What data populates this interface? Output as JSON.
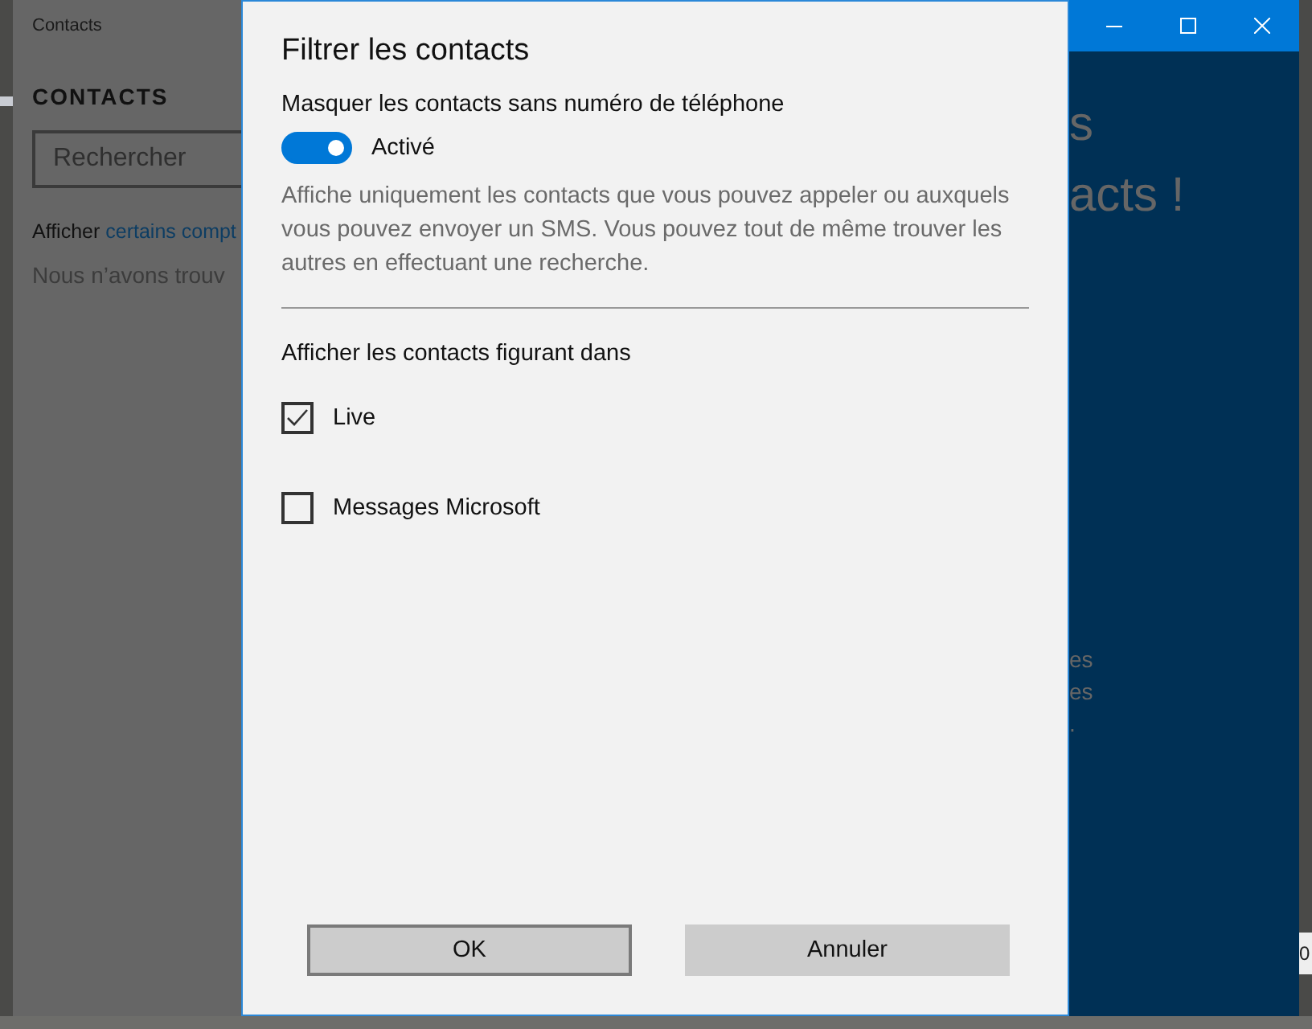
{
  "window": {
    "title": "Contacts"
  },
  "background_left": {
    "heading": "CONTACTS",
    "search": {
      "placeholder": "Rechercher"
    },
    "filter_text": "Afficher ",
    "filter_link": "certains compt",
    "empty_text": "Nous n’avons trouv"
  },
  "background_right": {
    "lines": [
      {
        "text": "s",
        "kind": "large"
      },
      {
        "text": "acts !",
        "kind": "large"
      },
      {
        "text": "es",
        "kind": "small"
      },
      {
        "text": "es",
        "kind": "small"
      },
      {
        "text": ".",
        "kind": "small"
      }
    ]
  },
  "dialog": {
    "title": "Filtrer les contacts",
    "toggle_label": "Masquer les contacts sans numéro de téléphone",
    "toggle": {
      "on": true,
      "label": "Activé"
    },
    "description": "Affiche uniquement les contacts que vous pouvez appeler ou auxquels vous pouvez envoyer un SMS. Vous pouvez tout de même trouver les autres en effectuant une recherche.",
    "sources_label": "Afficher les contacts figurant dans",
    "sources": [
      {
        "label": "Live",
        "checked": true
      },
      {
        "label": "Messages Microsoft",
        "checked": false
      }
    ],
    "buttons": [
      {
        "label": "OK",
        "focused": true
      },
      {
        "label": "Annuler",
        "focused": false
      }
    ]
  },
  "desktop": {
    "fragment": "0"
  }
}
